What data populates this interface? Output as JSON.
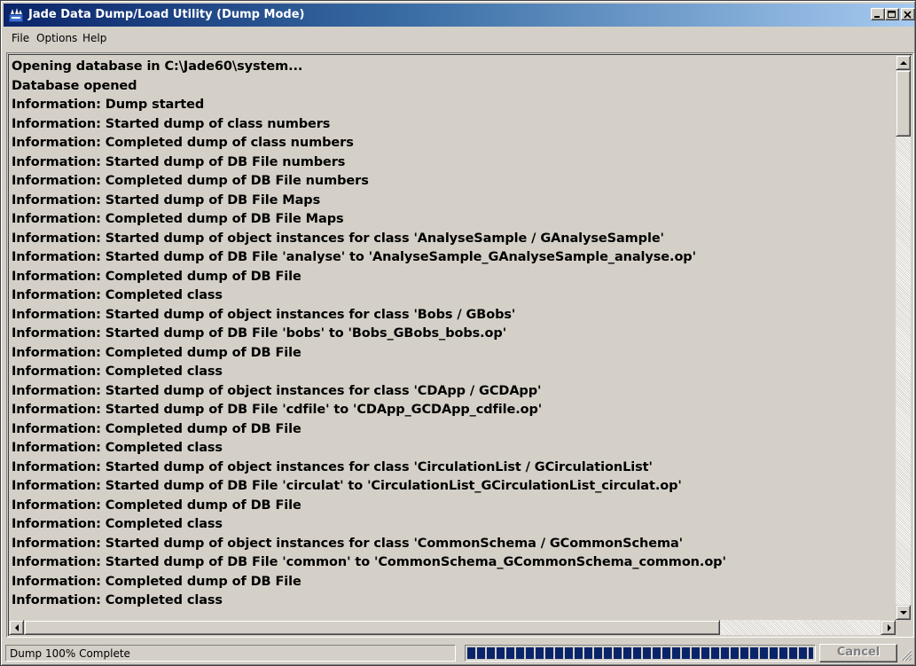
{
  "window": {
    "title": "Jade Data Dump/Load Utility (Dump Mode)",
    "accent_color": "#0a246a",
    "icon": "jade-app-icon"
  },
  "menu": {
    "items": [
      {
        "label": "File"
      },
      {
        "label": "Options"
      },
      {
        "label": "Help"
      }
    ]
  },
  "log": {
    "lines": [
      "Opening database in C:\\Jade60\\system...",
      "Database opened",
      "Information: Dump started",
      "Information: Started dump of class numbers",
      "Information: Completed dump of class numbers",
      "Information: Started dump of DB File numbers",
      "Information: Completed dump of DB File numbers",
      "Information: Started dump of DB File Maps",
      "Information: Completed dump of DB File Maps",
      "Information: Started dump of object instances for class 'AnalyseSample / GAnalyseSample'",
      "Information: Started dump of DB File 'analyse' to 'AnalyseSample_GAnalyseSample_analyse.op'",
      "Information: Completed dump of DB File",
      "Information: Completed class",
      "Information: Started dump of object instances for class 'Bobs / GBobs'",
      "Information: Started dump of DB File 'bobs' to 'Bobs_GBobs_bobs.op'",
      "Information: Completed dump of DB File",
      "Information: Completed class",
      "Information: Started dump of object instances for class 'CDApp / GCDApp'",
      "Information: Started dump of DB File 'cdfile' to 'CDApp_GCDApp_cdfile.op'",
      "Information: Completed dump of DB File",
      "Information: Completed class",
      "Information: Started dump of object instances for class 'CirculationList / GCirculationList'",
      "Information: Started dump of DB File 'circulat' to 'CirculationList_GCirculationList_circulat.op'",
      "Information: Completed dump of DB File",
      "Information: Completed class",
      "Information: Started dump of object instances for class 'CommonSchema / GCommonSchema'",
      "Information: Started dump of DB File 'common' to 'CommonSchema_GCommonSchema_common.op'",
      "Information: Completed dump of DB File",
      "Information: Completed class"
    ]
  },
  "status": {
    "text": "Dump 100% Complete",
    "progress_fraction": 1.0,
    "progress_color": "#0a246a",
    "cancel_label": "Cancel",
    "cancel_enabled": false
  }
}
